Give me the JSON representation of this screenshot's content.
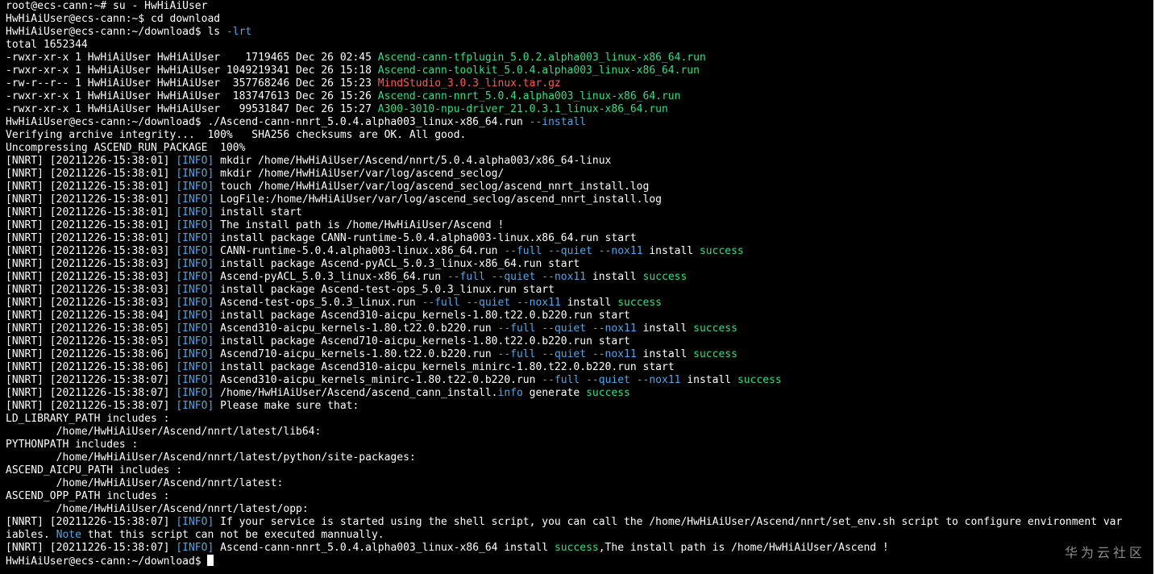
{
  "colors": {
    "background": "#000000",
    "text": "#ffffff",
    "executable_file": "#2ee08a",
    "archive_file": "#ff5a5a",
    "option": "#4ea8e8",
    "info_tag": "#4ea8e8",
    "success": "#2ee08a",
    "note": "#4ea8e8",
    "cursor": "#ffffff",
    "watermark": "#8c8c8c"
  },
  "terminal": {
    "lines": [
      [
        {
          "t": "root@ecs-cann:~# su - HwHiAiUser"
        }
      ],
      [
        {
          "t": "HwHiAiUser@ecs-cann:~$ cd download"
        }
      ],
      [
        {
          "t": "HwHiAiUser@ecs-cann:~/download$ ls "
        },
        {
          "t": "-lrt",
          "c": "option"
        }
      ],
      [
        {
          "t": "total 1652344"
        }
      ],
      [
        {
          "t": "-rwxr-xr-x 1 HwHiAiUser HwHiAiUser    1719465 Dec 26 02:45 "
        },
        {
          "t": "Ascend-cann-tfplugin_5.0.2.alpha003_linux-x86_64.run",
          "c": "executable_file"
        }
      ],
      [
        {
          "t": "-rwxr-xr-x 1 HwHiAiUser HwHiAiUser 1049219341 Dec 26 15:18 "
        },
        {
          "t": "Ascend-cann-toolkit_5.0.4.alpha003_linux-x86_64.run",
          "c": "executable_file"
        }
      ],
      [
        {
          "t": "-rw-r--r-- 1 HwHiAiUser HwHiAiUser  357768246 Dec 26 15:23 "
        },
        {
          "t": "MindStudio_3.0.3_linux.tar.gz",
          "c": "archive_file"
        }
      ],
      [
        {
          "t": "-rwxr-xr-x 1 HwHiAiUser HwHiAiUser  183747613 Dec 26 15:26 "
        },
        {
          "t": "Ascend-cann-nnrt_5.0.4.alpha003_linux-x86_64.run",
          "c": "executable_file"
        }
      ],
      [
        {
          "t": "-rwxr-xr-x 1 HwHiAiUser HwHiAiUser   99531847 Dec 26 15:27 "
        },
        {
          "t": "A300-3010-npu-driver_21.0.3.1_linux-x86_64.run",
          "c": "executable_file"
        }
      ],
      [
        {
          "t": "HwHiAiUser@ecs-cann:~/download$ ./Ascend-cann-nnrt_5.0.4.alpha003_linux-x86_64.run "
        },
        {
          "t": "--install",
          "c": "option"
        }
      ],
      [
        {
          "t": "Verifying archive integrity...  100%   SHA256 checksums are OK. All good."
        }
      ],
      [
        {
          "t": "Uncompressing ASCEND_RUN_PACKAGE  100%"
        }
      ],
      [
        {
          "t": "[NNRT] [20211226-15:38:01] "
        },
        {
          "t": "[INFO]",
          "c": "info_tag"
        },
        {
          "t": " mkdir /home/HwHiAiUser/Ascend/nnrt/5.0.4.alpha003/x86_64-linux"
        }
      ],
      [
        {
          "t": "[NNRT] [20211226-15:38:01] "
        },
        {
          "t": "[INFO]",
          "c": "info_tag"
        },
        {
          "t": " mkdir /home/HwHiAiUser/var/log/ascend_seclog/"
        }
      ],
      [
        {
          "t": "[NNRT] [20211226-15:38:01] "
        },
        {
          "t": "[INFO]",
          "c": "info_tag"
        },
        {
          "t": " touch /home/HwHiAiUser/var/log/ascend_seclog/ascend_nnrt_install.log"
        }
      ],
      [
        {
          "t": "[NNRT] [20211226-15:38:01] "
        },
        {
          "t": "[INFO]",
          "c": "info_tag"
        },
        {
          "t": " LogFile:/home/HwHiAiUser/var/log/ascend_seclog/ascend_nnrt_install.log"
        }
      ],
      [
        {
          "t": "[NNRT] [20211226-15:38:01] "
        },
        {
          "t": "[INFO]",
          "c": "info_tag"
        },
        {
          "t": " install start"
        }
      ],
      [
        {
          "t": "[NNRT] [20211226-15:38:01] "
        },
        {
          "t": "[INFO]",
          "c": "info_tag"
        },
        {
          "t": " The install path is /home/HwHiAiUser/Ascend !"
        }
      ],
      [
        {
          "t": "[NNRT] [20211226-15:38:01] "
        },
        {
          "t": "[INFO]",
          "c": "info_tag"
        },
        {
          "t": " install package CANN-runtime-5.0.4.alpha003-linux.x86_64.run start"
        }
      ],
      [
        {
          "t": "[NNRT] [20211226-15:38:03] "
        },
        {
          "t": "[INFO]",
          "c": "info_tag"
        },
        {
          "t": " CANN-runtime-5.0.4.alpha003-linux.x86_64.run "
        },
        {
          "t": "--full --quiet --nox11",
          "c": "option"
        },
        {
          "t": " install "
        },
        {
          "t": "success",
          "c": "success"
        }
      ],
      [
        {
          "t": "[NNRT] [20211226-15:38:03] "
        },
        {
          "t": "[INFO]",
          "c": "info_tag"
        },
        {
          "t": " install package Ascend-pyACL_5.0.3_linux-x86_64.run start"
        }
      ],
      [
        {
          "t": "[NNRT] [20211226-15:38:03] "
        },
        {
          "t": "[INFO]",
          "c": "info_tag"
        },
        {
          "t": " Ascend-pyACL_5.0.3_linux-x86_64.run "
        },
        {
          "t": "--full --quiet --nox11",
          "c": "option"
        },
        {
          "t": " install "
        },
        {
          "t": "success",
          "c": "success"
        }
      ],
      [
        {
          "t": "[NNRT] [20211226-15:38:03] "
        },
        {
          "t": "[INFO]",
          "c": "info_tag"
        },
        {
          "t": " install package Ascend-test-ops_5.0.3_linux.run start"
        }
      ],
      [
        {
          "t": "[NNRT] [20211226-15:38:03] "
        },
        {
          "t": "[INFO]",
          "c": "info_tag"
        },
        {
          "t": " Ascend-test-ops_5.0.3_linux.run "
        },
        {
          "t": "--full --quiet --nox11",
          "c": "option"
        },
        {
          "t": " install "
        },
        {
          "t": "success",
          "c": "success"
        }
      ],
      [
        {
          "t": "[NNRT] [20211226-15:38:04] "
        },
        {
          "t": "[INFO]",
          "c": "info_tag"
        },
        {
          "t": " install package Ascend310-aicpu_kernels-1.80.t22.0.b220.run start"
        }
      ],
      [
        {
          "t": "[NNRT] [20211226-15:38:05] "
        },
        {
          "t": "[INFO]",
          "c": "info_tag"
        },
        {
          "t": " Ascend310-aicpu_kernels-1.80.t22.0.b220.run "
        },
        {
          "t": "--full --quiet --nox11",
          "c": "option"
        },
        {
          "t": " install "
        },
        {
          "t": "success",
          "c": "success"
        }
      ],
      [
        {
          "t": "[NNRT] [20211226-15:38:05] "
        },
        {
          "t": "[INFO]",
          "c": "info_tag"
        },
        {
          "t": " install package Ascend710-aicpu_kernels-1.80.t22.0.b220.run start"
        }
      ],
      [
        {
          "t": "[NNRT] [20211226-15:38:06] "
        },
        {
          "t": "[INFO]",
          "c": "info_tag"
        },
        {
          "t": " Ascend710-aicpu_kernels-1.80.t22.0.b220.run "
        },
        {
          "t": "--full --quiet --nox11",
          "c": "option"
        },
        {
          "t": " install "
        },
        {
          "t": "success",
          "c": "success"
        }
      ],
      [
        {
          "t": "[NNRT] [20211226-15:38:06] "
        },
        {
          "t": "[INFO]",
          "c": "info_tag"
        },
        {
          "t": " install package Ascend310-aicpu_kernels_minirc-1.80.t22.0.b220.run start"
        }
      ],
      [
        {
          "t": "[NNRT] [20211226-15:38:07] "
        },
        {
          "t": "[INFO]",
          "c": "info_tag"
        },
        {
          "t": " Ascend310-aicpu_kernels_minirc-1.80.t22.0.b220.run "
        },
        {
          "t": "--full --quiet --nox11",
          "c": "option"
        },
        {
          "t": " install "
        },
        {
          "t": "success",
          "c": "success"
        }
      ],
      [
        {
          "t": "[NNRT] [20211226-15:38:07] "
        },
        {
          "t": "[INFO]",
          "c": "info_tag"
        },
        {
          "t": " /home/HwHiAiUser/Ascend/ascend_cann_install."
        },
        {
          "t": "info",
          "c": "option"
        },
        {
          "t": " generate "
        },
        {
          "t": "success",
          "c": "success"
        }
      ],
      [
        {
          "t": "[NNRT] [20211226-15:38:07] "
        },
        {
          "t": "[INFO]",
          "c": "info_tag"
        },
        {
          "t": " Please make sure that:"
        }
      ],
      [
        {
          "t": "LD_LIBRARY_PATH includes :"
        }
      ],
      [
        {
          "t": "        /home/HwHiAiUser/Ascend/nnrt/latest/lib64:"
        }
      ],
      [
        {
          "t": "PYTHONPATH includes :"
        }
      ],
      [
        {
          "t": "        /home/HwHiAiUser/Ascend/nnrt/latest/python/site-packages:"
        }
      ],
      [
        {
          "t": "ASCEND_AICPU_PATH includes :"
        }
      ],
      [
        {
          "t": "        /home/HwHiAiUser/Ascend/nnrt/latest:"
        }
      ],
      [
        {
          "t": "ASCEND_OPP_PATH includes :"
        }
      ],
      [
        {
          "t": "        /home/HwHiAiUser/Ascend/nnrt/latest/opp:"
        }
      ],
      [
        {
          "t": "[NNRT] [20211226-15:38:07] "
        },
        {
          "t": "[INFO]",
          "c": "info_tag"
        },
        {
          "t": " If your service is started using the shell script, you can call the /home/HwHiAiUser/Ascend/nnrt/set_env.sh script to configure environment var"
        }
      ],
      [
        {
          "t": "iables. "
        },
        {
          "t": "Note",
          "c": "note"
        },
        {
          "t": " that this script can not be executed mannually."
        }
      ],
      [
        {
          "t": "[NNRT] [20211226-15:38:07] "
        },
        {
          "t": "[INFO]",
          "c": "info_tag"
        },
        {
          "t": " Ascend-cann-nnrt_5.0.4.alpha003_linux-x86_64 install "
        },
        {
          "t": "success",
          "c": "success"
        },
        {
          "t": ",The install path is /home/HwHiAiUser/Ascend !"
        }
      ],
      [
        {
          "t": "HwHiAiUser@ecs-cann:~/download$ "
        }
      ]
    ]
  },
  "watermark": {
    "text": "华为云社区"
  }
}
